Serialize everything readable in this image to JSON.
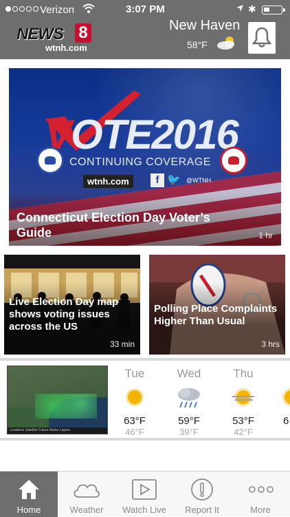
{
  "status_bar": {
    "carrier": "Verizon",
    "time": "3:07 PM",
    "signal_bars": 1,
    "battery_level": 0.35
  },
  "header": {
    "logo": {
      "brand": "NEWS",
      "number": "8",
      "site": "wtnh.com"
    },
    "location": "New Haven",
    "temperature": "58°F",
    "weather_icon": "partly-cloudy-icon",
    "alerts_icon": "bell-icon"
  },
  "hero": {
    "image_text": {
      "vote_lead": "V",
      "vote_rest": "OTE2016",
      "subtitle": "CONTINUING COVERAGE",
      "site": "wtnh.com",
      "handle": "@WTNH"
    },
    "headline": "Connecticut Election Day Voter’s Guide",
    "age": "1 hr"
  },
  "stories": [
    {
      "headline": "Live Election Day map shows voting issues across the US",
      "age": "33 min"
    },
    {
      "headline": "Polling Place Complaints Higher Than Usual",
      "age": "3 hrs"
    }
  ],
  "weather": {
    "radar_caption": "Locations  Satellite  Future  Radar  Layers",
    "forecast": [
      {
        "day": "Tue",
        "icon": "sun-icon",
        "high": "63°F",
        "low": "46°F"
      },
      {
        "day": "Wed",
        "icon": "rain-cloud-icon",
        "high": "59°F",
        "low": "39°F"
      },
      {
        "day": "Thu",
        "icon": "sun-wind-icon",
        "high": "53°F",
        "low": "42°F"
      }
    ],
    "partial_next_high": "6"
  },
  "tabs": [
    {
      "label": "Home",
      "icon": "house-icon",
      "active": true
    },
    {
      "label": "Weather",
      "icon": "cloud-icon",
      "active": false
    },
    {
      "label": "Watch Live",
      "icon": "play-icon",
      "active": false
    },
    {
      "label": "Report It",
      "icon": "exclamation-icon",
      "active": false
    },
    {
      "label": "More",
      "icon": "ellipsis-icon",
      "active": false
    }
  ]
}
